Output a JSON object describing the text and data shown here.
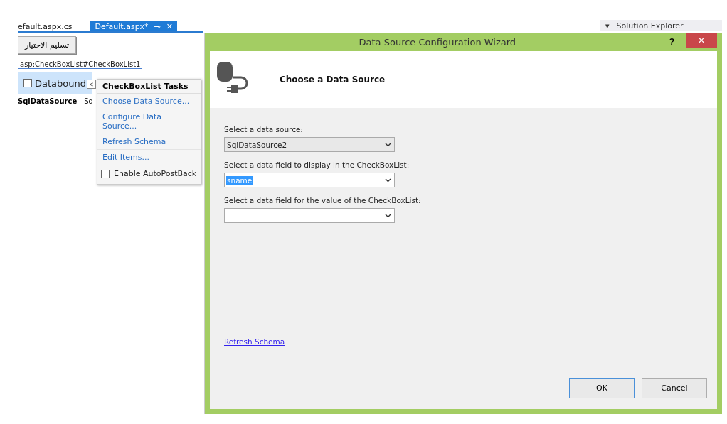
{
  "document_tabs": [
    {
      "label": "efault.aspx.cs",
      "selected": false
    },
    {
      "label": "Default.aspx*",
      "selected": true,
      "pin": "⊸",
      "close": "✕"
    }
  ],
  "solution_explorer": {
    "caret": "▾",
    "title": "Solution Explorer"
  },
  "designer": {
    "submit_button": "تسليم الاختيار",
    "control_tag": "asp:CheckBoxList#CheckBoxList1",
    "checkbox_item": {
      "label": "Databound",
      "checked": false
    },
    "datasource_label": "SqlDataSource",
    "datasource_suffix": " - Sq"
  },
  "smart_tasks": {
    "toggle": "<",
    "title": "CheckBoxList Tasks",
    "links": [
      "Choose Data Source...",
      "Configure Data Source...",
      "Refresh Schema",
      "Edit Items..."
    ],
    "autopostback": {
      "label": "Enable AutoPostBack",
      "checked": false
    }
  },
  "dialog": {
    "title": "Data Source Configuration Wizard",
    "help": "?",
    "close": "✕",
    "heading": "Choose a Data Source",
    "fields": [
      {
        "label": "Select a data source:",
        "value": "SqlDataSource2"
      },
      {
        "label": "Select a data field to display in the CheckBoxList:",
        "value": "sname",
        "highlighted": true
      },
      {
        "label": "Select a data field for the value of the CheckBoxList:"
      }
    ],
    "refresh_link": "Refresh Schema",
    "buttons": [
      {
        "label": "OK",
        "selected": true
      },
      {
        "label": "Cancel",
        "selected": false
      }
    ]
  }
}
